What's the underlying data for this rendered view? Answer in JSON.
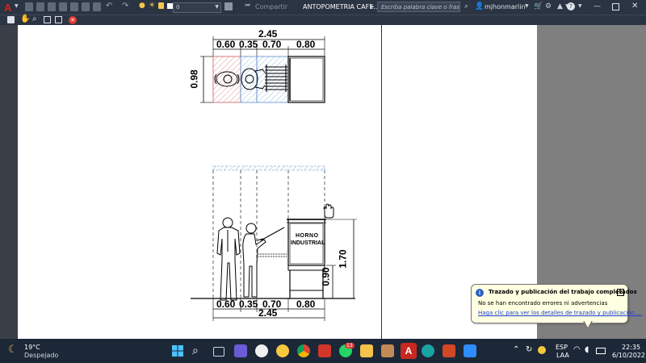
{
  "app": {
    "document_title": "ANTOPOMETRIA CAFE...",
    "share_label": "Compartir",
    "layer_value": "0",
    "search_placeholder": "Escriba palabra clave o frase",
    "username": "mjhonmarlin",
    "accent_color": "#c8281e"
  },
  "drawing": {
    "plan": {
      "total_width": "2.45",
      "segments": [
        "0.60",
        "0.35",
        "0.70",
        "0.80"
      ],
      "depth": "0.98"
    },
    "elevation": {
      "oven_label_line1": "HORNO",
      "oven_label_line2": "INDUSTRIAL",
      "total_width": "2.45",
      "segments": [
        "0.60",
        "0.35",
        "0.70",
        "0.80"
      ],
      "counter_height": "0.90",
      "total_height": "1.70"
    }
  },
  "notification": {
    "title": "Trazado y publicación del trabajo completados",
    "message": "No se han encontrado errores ni advertencias",
    "link": "Haga clic para ver los detalles de trazado y publicación...."
  },
  "taskbar": {
    "weather_temp": "19°C",
    "weather_desc": "Despejado",
    "badge_count": "13",
    "language_line1": "ESP",
    "language_line2": "LAA",
    "time": "22:35",
    "date": "6/10/2022"
  }
}
